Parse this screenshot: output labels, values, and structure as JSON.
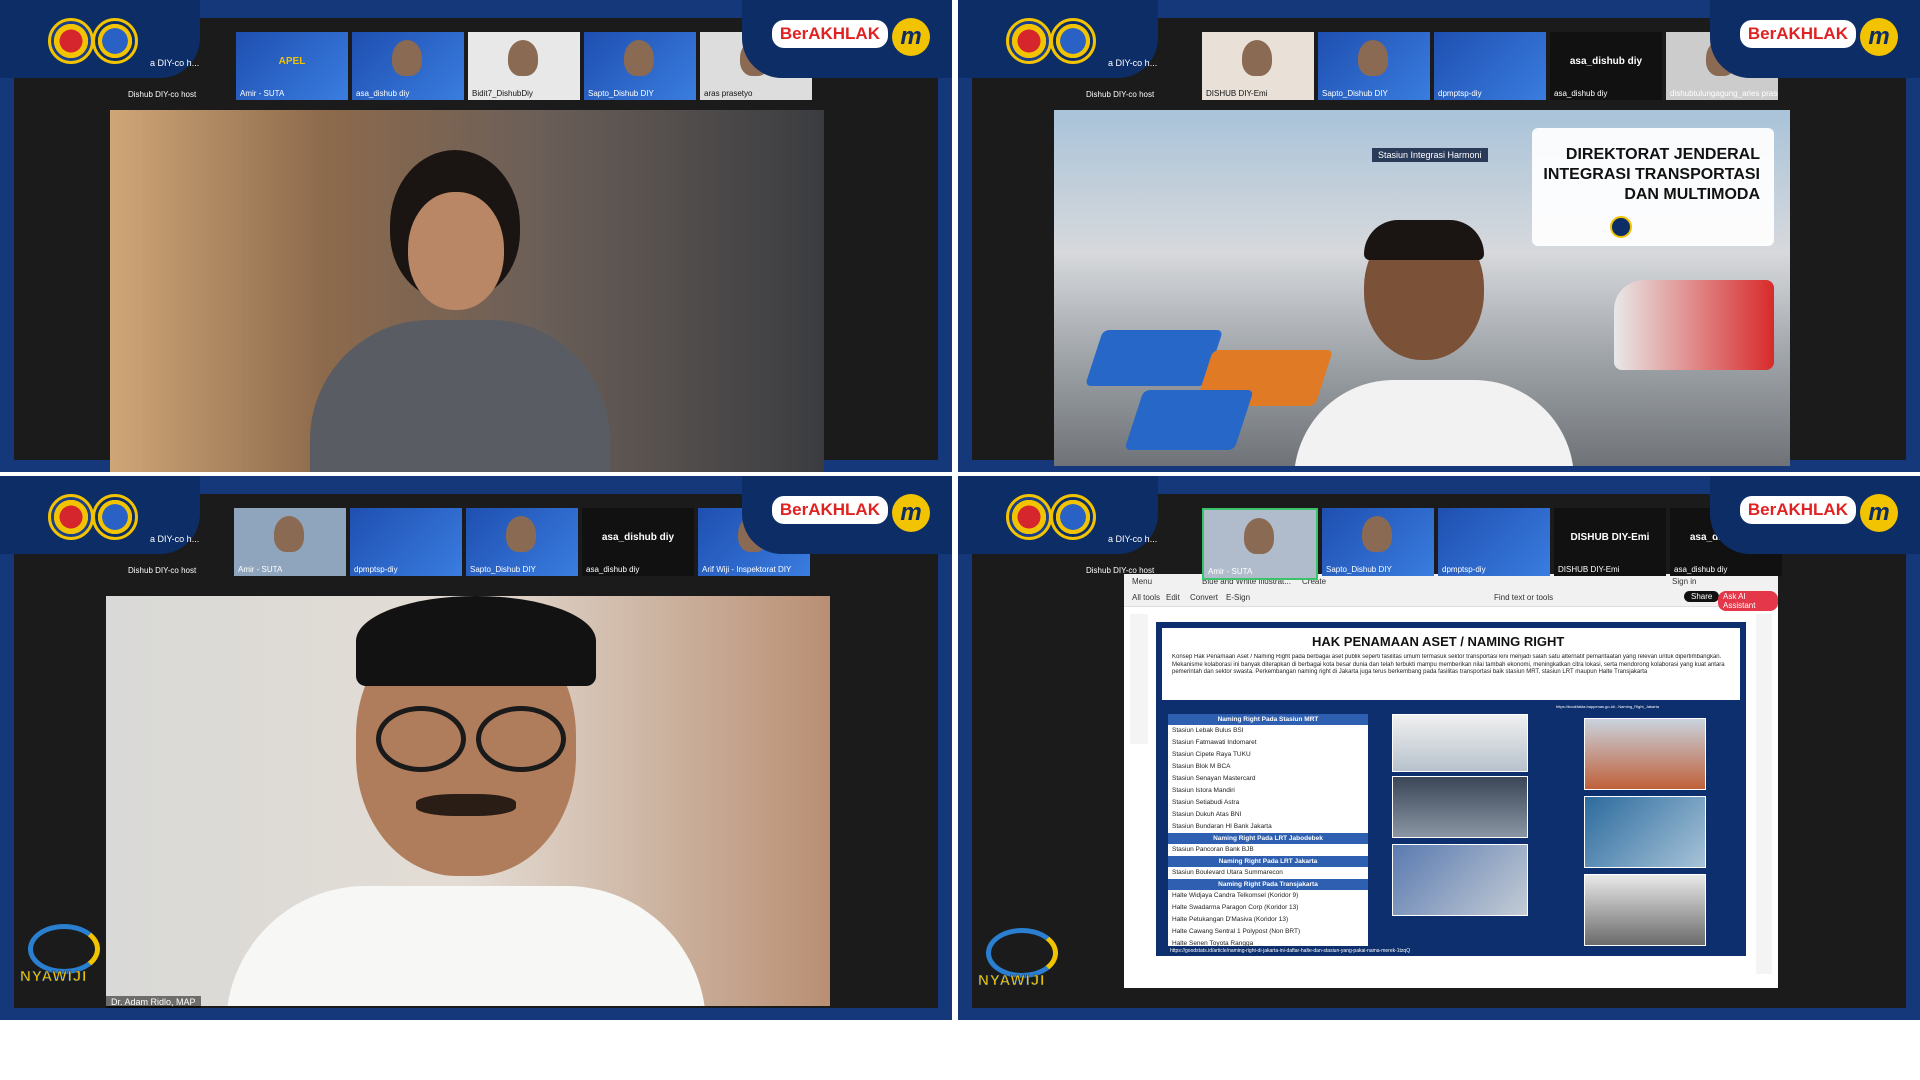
{
  "branding": {
    "berakhlak": "BerAKHLAK",
    "m_badge": "m",
    "nyawiji": "NYAWIJI"
  },
  "quad1": {
    "host_label": "a DIY-co h...",
    "host_caption": "Dishub DIY-co host",
    "tiles": [
      {
        "caption": "Amir - SUTA",
        "title": "APEL"
      },
      {
        "caption": "asa_dishub diy"
      },
      {
        "caption": "Bidit7_DishubDiy"
      },
      {
        "caption": "Sapto_Dishub DIY"
      },
      {
        "caption": "aras prasetyo"
      }
    ]
  },
  "quad2": {
    "host_label": "a DIY-co h...",
    "host_caption": "Dishub DIY-co host",
    "tiles": [
      {
        "caption": "DISHUB DIY-Emi"
      },
      {
        "caption": "Sapto_Dishub DIY"
      },
      {
        "caption": "dpmptsp-diy"
      },
      {
        "caption": "asa_dishub diy",
        "mid": "asa_dishub diy"
      },
      {
        "caption": "dishubtulungagung_aries prasel..."
      }
    ],
    "slide_title_lines": [
      "DIREKTORAT JENDERAL",
      "INTEGRASI TRANSPORTASI",
      "DAN MULTIMODA"
    ],
    "station_sign": "Stasiun Integrasi Harmoni"
  },
  "quad3": {
    "host_label": "a DIY-co h...",
    "host_caption": "Dishub DIY-co host",
    "tiles": [
      {
        "caption": "Amir - SUTA"
      },
      {
        "caption": "dpmptsp-diy"
      },
      {
        "caption": "Sapto_Dishub DIY"
      },
      {
        "caption": "asa_dishub diy",
        "mid": "asa_dishub diy"
      },
      {
        "caption": "Arif Wiji - Inspektorat DIY"
      }
    ],
    "speaker_caption": "Dr. Adam Ridlo, MAP"
  },
  "quad4": {
    "host_label": "a DIY-co h...",
    "host_caption": "Dishub DIY-co host",
    "tiles": [
      {
        "caption": "Amir - SUTA"
      },
      {
        "caption": "Sapto_Dishub DIY"
      },
      {
        "caption": "dpmptsp-diy"
      },
      {
        "caption": "DISHUB DIY-Emi",
        "mid": "DISHUB DIY-Emi"
      },
      {
        "caption": "asa_dishub diy",
        "mid": "asa_dishub diy"
      }
    ],
    "pdf": {
      "menu": "Menu",
      "tab": "Blue and White Illustrat...",
      "create": "Create",
      "sign_in": "Sign in",
      "tools": [
        "All tools",
        "Edit",
        "Convert",
        "E-Sign"
      ],
      "find": "Find text or tools",
      "share": "Share",
      "ai": "Ask AI Assistant"
    },
    "slide": {
      "title": "HAK PENAMAAN ASET / NAMING RIGHT",
      "para": "Konsep Hak Penamaan Aset / Naming Right pada berbagai aset publik seperti fasilitas umum termasuk sektor transportasi kini menjadi salah satu alternatif pemanfaatan yang relevan untuk dipertimbangkan. Mekanisme kolaborasi ini banyak diterapkan di berbagai kota besar dunia dan telah terbukti mampu memberikan nilai tambah ekonomi, meningkatkan citra lokasi, serta mendorong kolaborasi yang kuat antara pemerintah dan sektor swasta. Perkembangan naming right di Jakarta juga terus berkembang pada fasilitas transportasi baik stasiun MRT, stasiun LRT maupun Halte Transjakarta",
      "groups": [
        {
          "head": "Naming Right Pada Stasiun MRT",
          "rows": [
            "Stasiun Lebak Bulus BSI",
            "Stasiun Fatmawati Indomaret",
            "Stasiun Cipete Raya TUKU",
            "Stasiun Blok M BCA",
            "Stasiun Senayan Mastercard",
            "Stasiun Istora Mandiri",
            "Stasiun Setiabudi Astra",
            "Stasiun Dukuh Atas BNI",
            "Stasiun Bundaran HI Bank Jakarta"
          ]
        },
        {
          "head": "Naming Right Pada LRT Jabodebek",
          "rows": [
            "Stasiun Pancoran Bank BJB"
          ]
        },
        {
          "head": "Naming Right Pada LRT Jakarta",
          "rows": [
            "Stasiun Boulevard Utara Summarecon"
          ]
        },
        {
          "head": "Naming Right Pada Transjakarta",
          "rows": [
            "Halte Widjaya Candra Telkomsel (Koridor 9)",
            "Halte Swadarma Paragon Corp (Koridor 13)",
            "Halte Petukangan D'Masiva (Koridor 13)",
            "Halte Cawang Sentral 1 Polypost (Non BRT)",
            "Halte Senen Toyota Rangga"
          ]
        }
      ],
      "footer_url": "https://goodstats.id/article/naming-right-di-jakarta-ini-daftar-halte-dan-stasiun-yang-pakai-nama-merek-1tzqQ",
      "ref_text": "https://bookfakta.bappenas.go.id/...Naming_Right_Jakarta"
    }
  }
}
